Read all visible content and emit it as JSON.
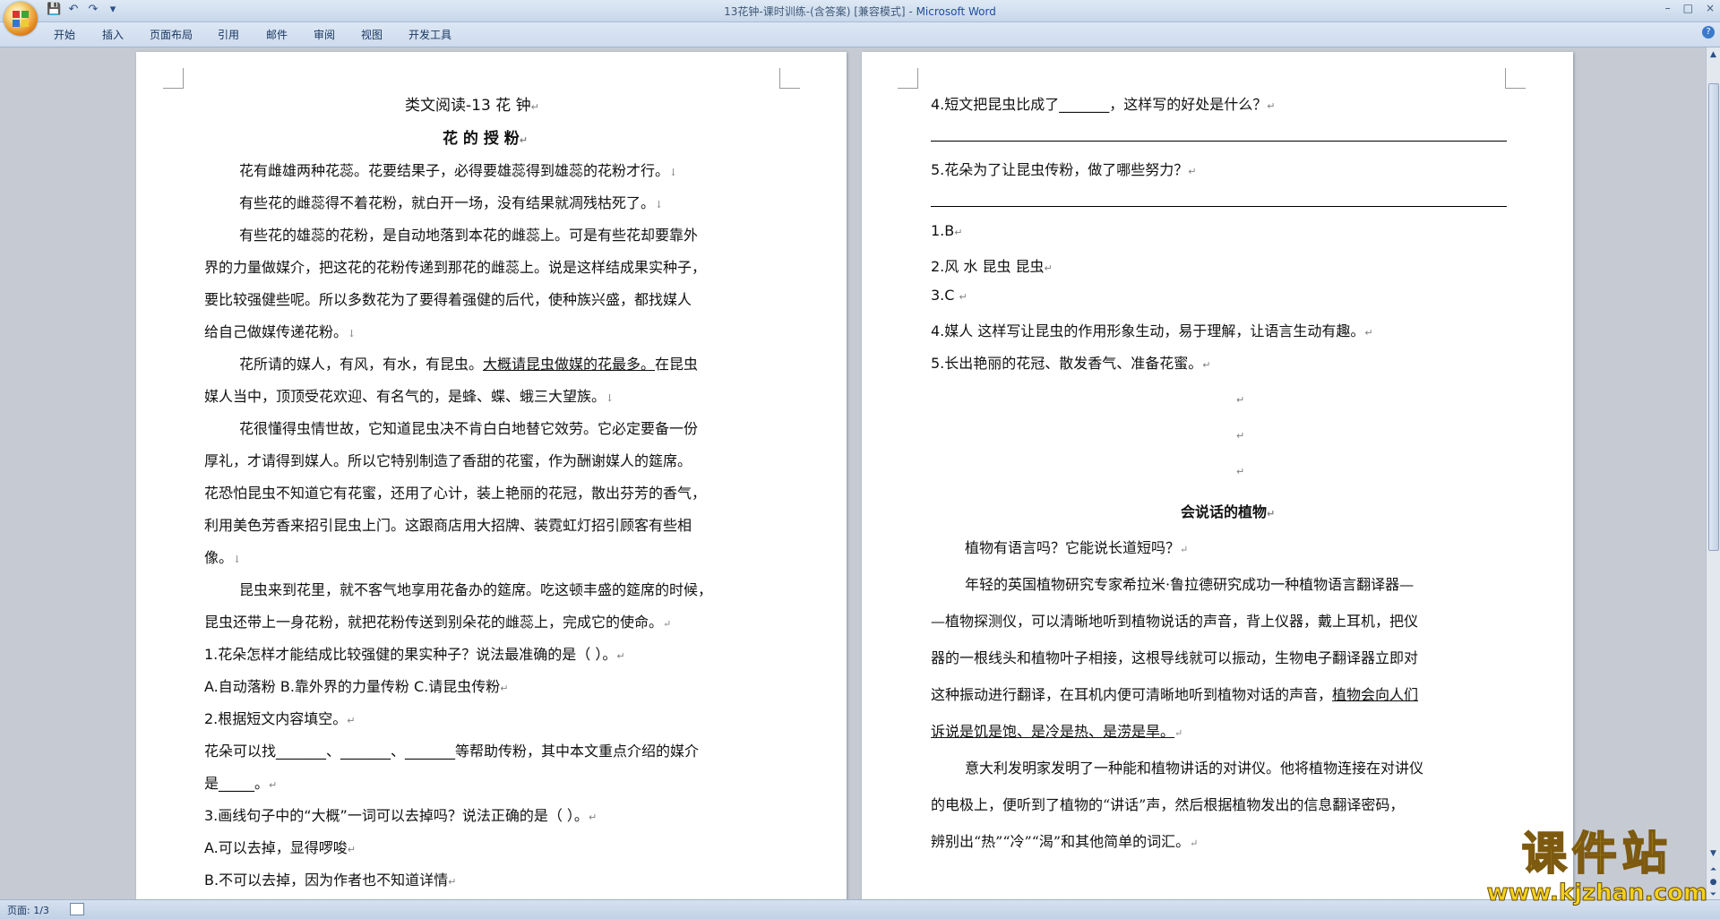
{
  "window": {
    "title": "13花钟-课时训练-(含答案) [兼容模式] - ",
    "app_name": "Microsoft Word",
    "controls": [
      "–",
      "□",
      "×"
    ]
  },
  "quick_access": {
    "icons": [
      "save-icon",
      "undo-icon",
      "redo-icon",
      "customize-icon"
    ],
    "glyphs": [
      "💾",
      "↶",
      "↷",
      "▾"
    ]
  },
  "ribbon": {
    "tabs": [
      "开始",
      "插入",
      "页面布局",
      "引用",
      "邮件",
      "审阅",
      "视图",
      "开发工具"
    ]
  },
  "left_page": {
    "title": "类文阅读-13 花    钟",
    "subtitle": "花 的 授 粉",
    "paragraphs": [
      "花有雌雄两种花蕊。花要结果子，必得要雄蕊得到雄蕊的花粉才行。",
      "有些花的雌蕊得不着花粉，就白开一场，没有结果就凋残枯死了。",
      "有些花的雄蕊的花粉，是自动地落到本花的雌蕊上。可是有些花却要靠外",
      "界的力量做媒介，把这花的花粉传递到那花的雌蕊上。说是这样结成果实种子，",
      "要比较强健些呢。所以多数花为了要得着强健的后代，使种族兴盛，都找媒人",
      "给自己做媒传递花粉。",
      "花所请的媒人，有风，有水，有昆虫。",
      "大概请昆虫做媒的花最多。",
      "在昆虫",
      "媒人当中，顶顶受花欢迎、有名气的，是蜂、蝶、蛾三大望族。",
      "花很懂得虫情世故，它知道昆虫决不肯白白地替它效劳。它必定要备一份",
      "厚礼，才请得到媒人。所以它特别制造了香甜的花蜜，作为酬谢媒人的筵席。",
      "花恐怕昆虫不知道它有花蜜，还用了心计，装上艳丽的花冠，散出芬芳的香气，",
      "利用美色芳香来招引昆虫上门。这跟商店用大招牌、装霓虹灯招引顾客有些相",
      "像。",
      "昆虫来到花里，就不客气地享用花备办的筵席。吃这顿丰盛的筵席的时候，",
      "昆虫还带上一身花粉，就把花粉传送到别朵花的雌蕊上，完成它的使命。"
    ],
    "questions": [
      "1.花朵怎样才能结成比较强健的果实种子？说法最准确的是（    ）。",
      "A.自动落粉    B.靠外界的力量传粉    C.请昆虫传粉",
      "2.根据短文内容填空。",
      "花朵可以找_______、_______、_______等帮助传粉，其中本文重点介绍的媒介",
      "是_____。",
      "3.画线句子中的“大概”一词可以去掉吗？说法正确的是（    ）。",
      "A.可以去掉，显得啰唆",
      "B.不可以去掉，因为作者也不知道详情"
    ]
  },
  "right_page": {
    "q4": "4.短文把昆虫比成了_______，这样写的好处是什么？",
    "q5": "5.花朵为了让昆虫传粉，做了哪些努力？",
    "answers": [
      "1.B",
      "2.风 水 昆虫   昆虫",
      "3.C ",
      "4.媒人    这样写让昆虫的作用形象生动，易于理解，让语言生动有趣。",
      "5.长出艳丽的花冠、散发香气、准备花蜜。"
    ],
    "article_title": "会说话的植物",
    "article_lines": [
      "植物有语言吗？它能说长道短吗？",
      "年轻的英国植物研究专家希拉米·鲁拉德研究成功一种植物语言翻译器—",
      "—植物探测仪，可以清晰地听到植物说话的声音，背上仪器，戴上耳机，把仪",
      "器的一根线头和植物叶子相接，这根导线就可以振动，生物电子翻译器立即对",
      "这种振动进行翻译，在耳机内便可清晰地听到植物对话的声音，",
      "植物会向人们",
      "诉说是饥是饱、是冷是热、是涝是旱。",
      "意大利发明家发明了一种能和植物讲话的对讲仪。他将植物连接在对讲仪",
      "的电极上，便听到了植物的“讲话”声，然后根据植物发出的信息翻译密码，",
      "辨别出“热”“冷”“渴”和其他简单的词汇。"
    ]
  },
  "marks": {
    "paragraph": "↵",
    "line": "↓"
  },
  "status_bar": {
    "page": "页面: 1/3"
  },
  "watermark": {
    "cn": "课件站",
    "url": "www.kjzhan.com"
  }
}
